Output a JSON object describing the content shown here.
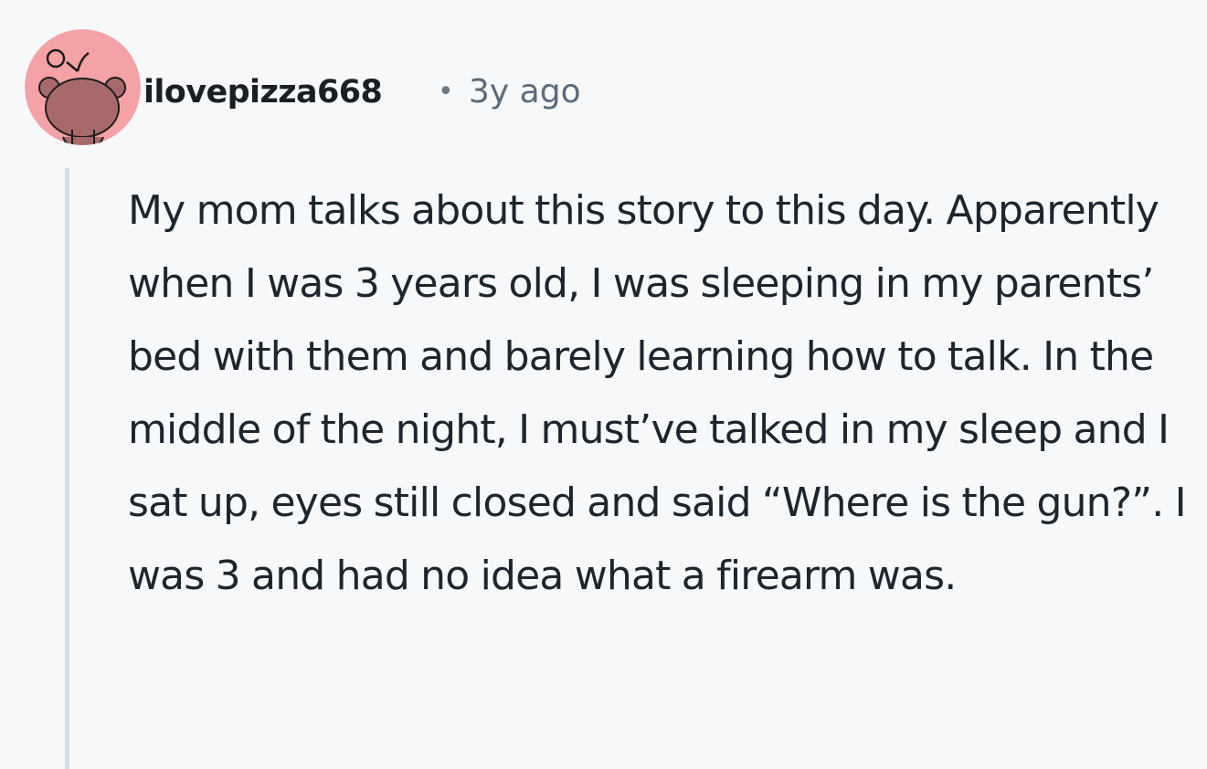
{
  "comment": {
    "author": "ilovepizza668",
    "separator": "•",
    "time": "3y ago",
    "body": "My mom talks about this story to this day. Apparently when I was 3 years old, I was sleeping in my parents’ bed with them and barely learning how to talk. In the middle of the night, I must’ve talked in my sleep and I sat up, eyes still closed and said “Where is the gun?”. I was 3 and had no idea what a firearm was.",
    "avatar_icon": "snoo-avatar-icon"
  },
  "colors": {
    "background": "#f6f8fa",
    "avatar_bg": "#f4a2a6",
    "avatar_figure": "#a8696d",
    "thread_line": "#d2dfe9"
  }
}
